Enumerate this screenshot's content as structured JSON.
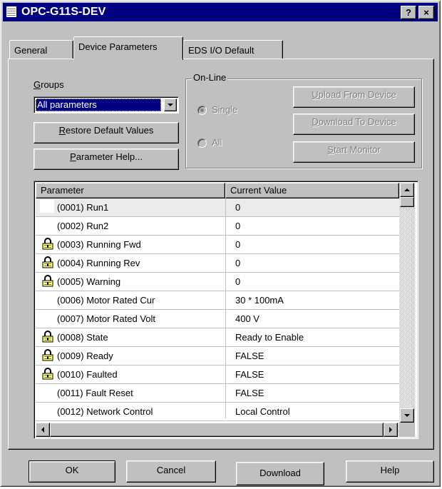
{
  "window": {
    "title": "OPC-G11S-DEV",
    "help_glyph": "?",
    "close_glyph": "×"
  },
  "tabs": [
    {
      "label": "General"
    },
    {
      "label": "Device Parameters"
    },
    {
      "label": "EDS I/O Default"
    }
  ],
  "groups": {
    "label": "Groups",
    "accel": "G",
    "label_rest": "roups",
    "selected": "All parameters"
  },
  "buttons": {
    "restore_accel": "R",
    "restore_rest": "estore Default Values",
    "help_accel": "P",
    "help_rest": "arameter Help..."
  },
  "online": {
    "title": "On-Line",
    "radio_single": "Single",
    "radio_all": "All",
    "upload_accel": "U",
    "upload_rest": "pload From Device",
    "download_accel": "D",
    "download_rest": "ownload To Device",
    "monitor_accel": "S",
    "monitor_rest": "tart Monitor"
  },
  "table": {
    "columns": [
      "Parameter",
      "Current Value"
    ],
    "rows": [
      {
        "param": "(0001) Run1",
        "value": "0",
        "locked": false
      },
      {
        "param": "(0002) Run2",
        "value": "0",
        "locked": false
      },
      {
        "param": "(0003) Running Fwd",
        "value": "0",
        "locked": true
      },
      {
        "param": "(0004) Running Rev",
        "value": "0",
        "locked": true
      },
      {
        "param": "(0005) Warning",
        "value": "0",
        "locked": true
      },
      {
        "param": "(0006) Motor Rated Cur",
        "value": "30 * 100mA",
        "locked": false
      },
      {
        "param": "(0007) Motor Rated Volt",
        "value": "400 V",
        "locked": false
      },
      {
        "param": "(0008) State",
        "value": "Ready to Enable",
        "locked": true
      },
      {
        "param": "(0009) Ready",
        "value": "FALSE",
        "locked": true
      },
      {
        "param": "(0010) Faulted",
        "value": "FALSE",
        "locked": true
      },
      {
        "param": "(0011) Fault Reset",
        "value": "FALSE",
        "locked": false
      },
      {
        "param": "(0012) Network Control",
        "value": "Local Control",
        "locked": false
      }
    ]
  },
  "footer": {
    "ok": "OK",
    "cancel": "Cancel",
    "download": "Download",
    "help": "Help"
  },
  "colors": {
    "titlebar": "#000080",
    "face": "#c0c0c0",
    "selection": "#000080"
  },
  "icons": [
    "lock-icon",
    "dropdown-arrow-icon",
    "scroll-up-arrow-icon",
    "scroll-down-arrow-icon",
    "scroll-left-arrow-icon",
    "scroll-right-arrow-icon"
  ]
}
